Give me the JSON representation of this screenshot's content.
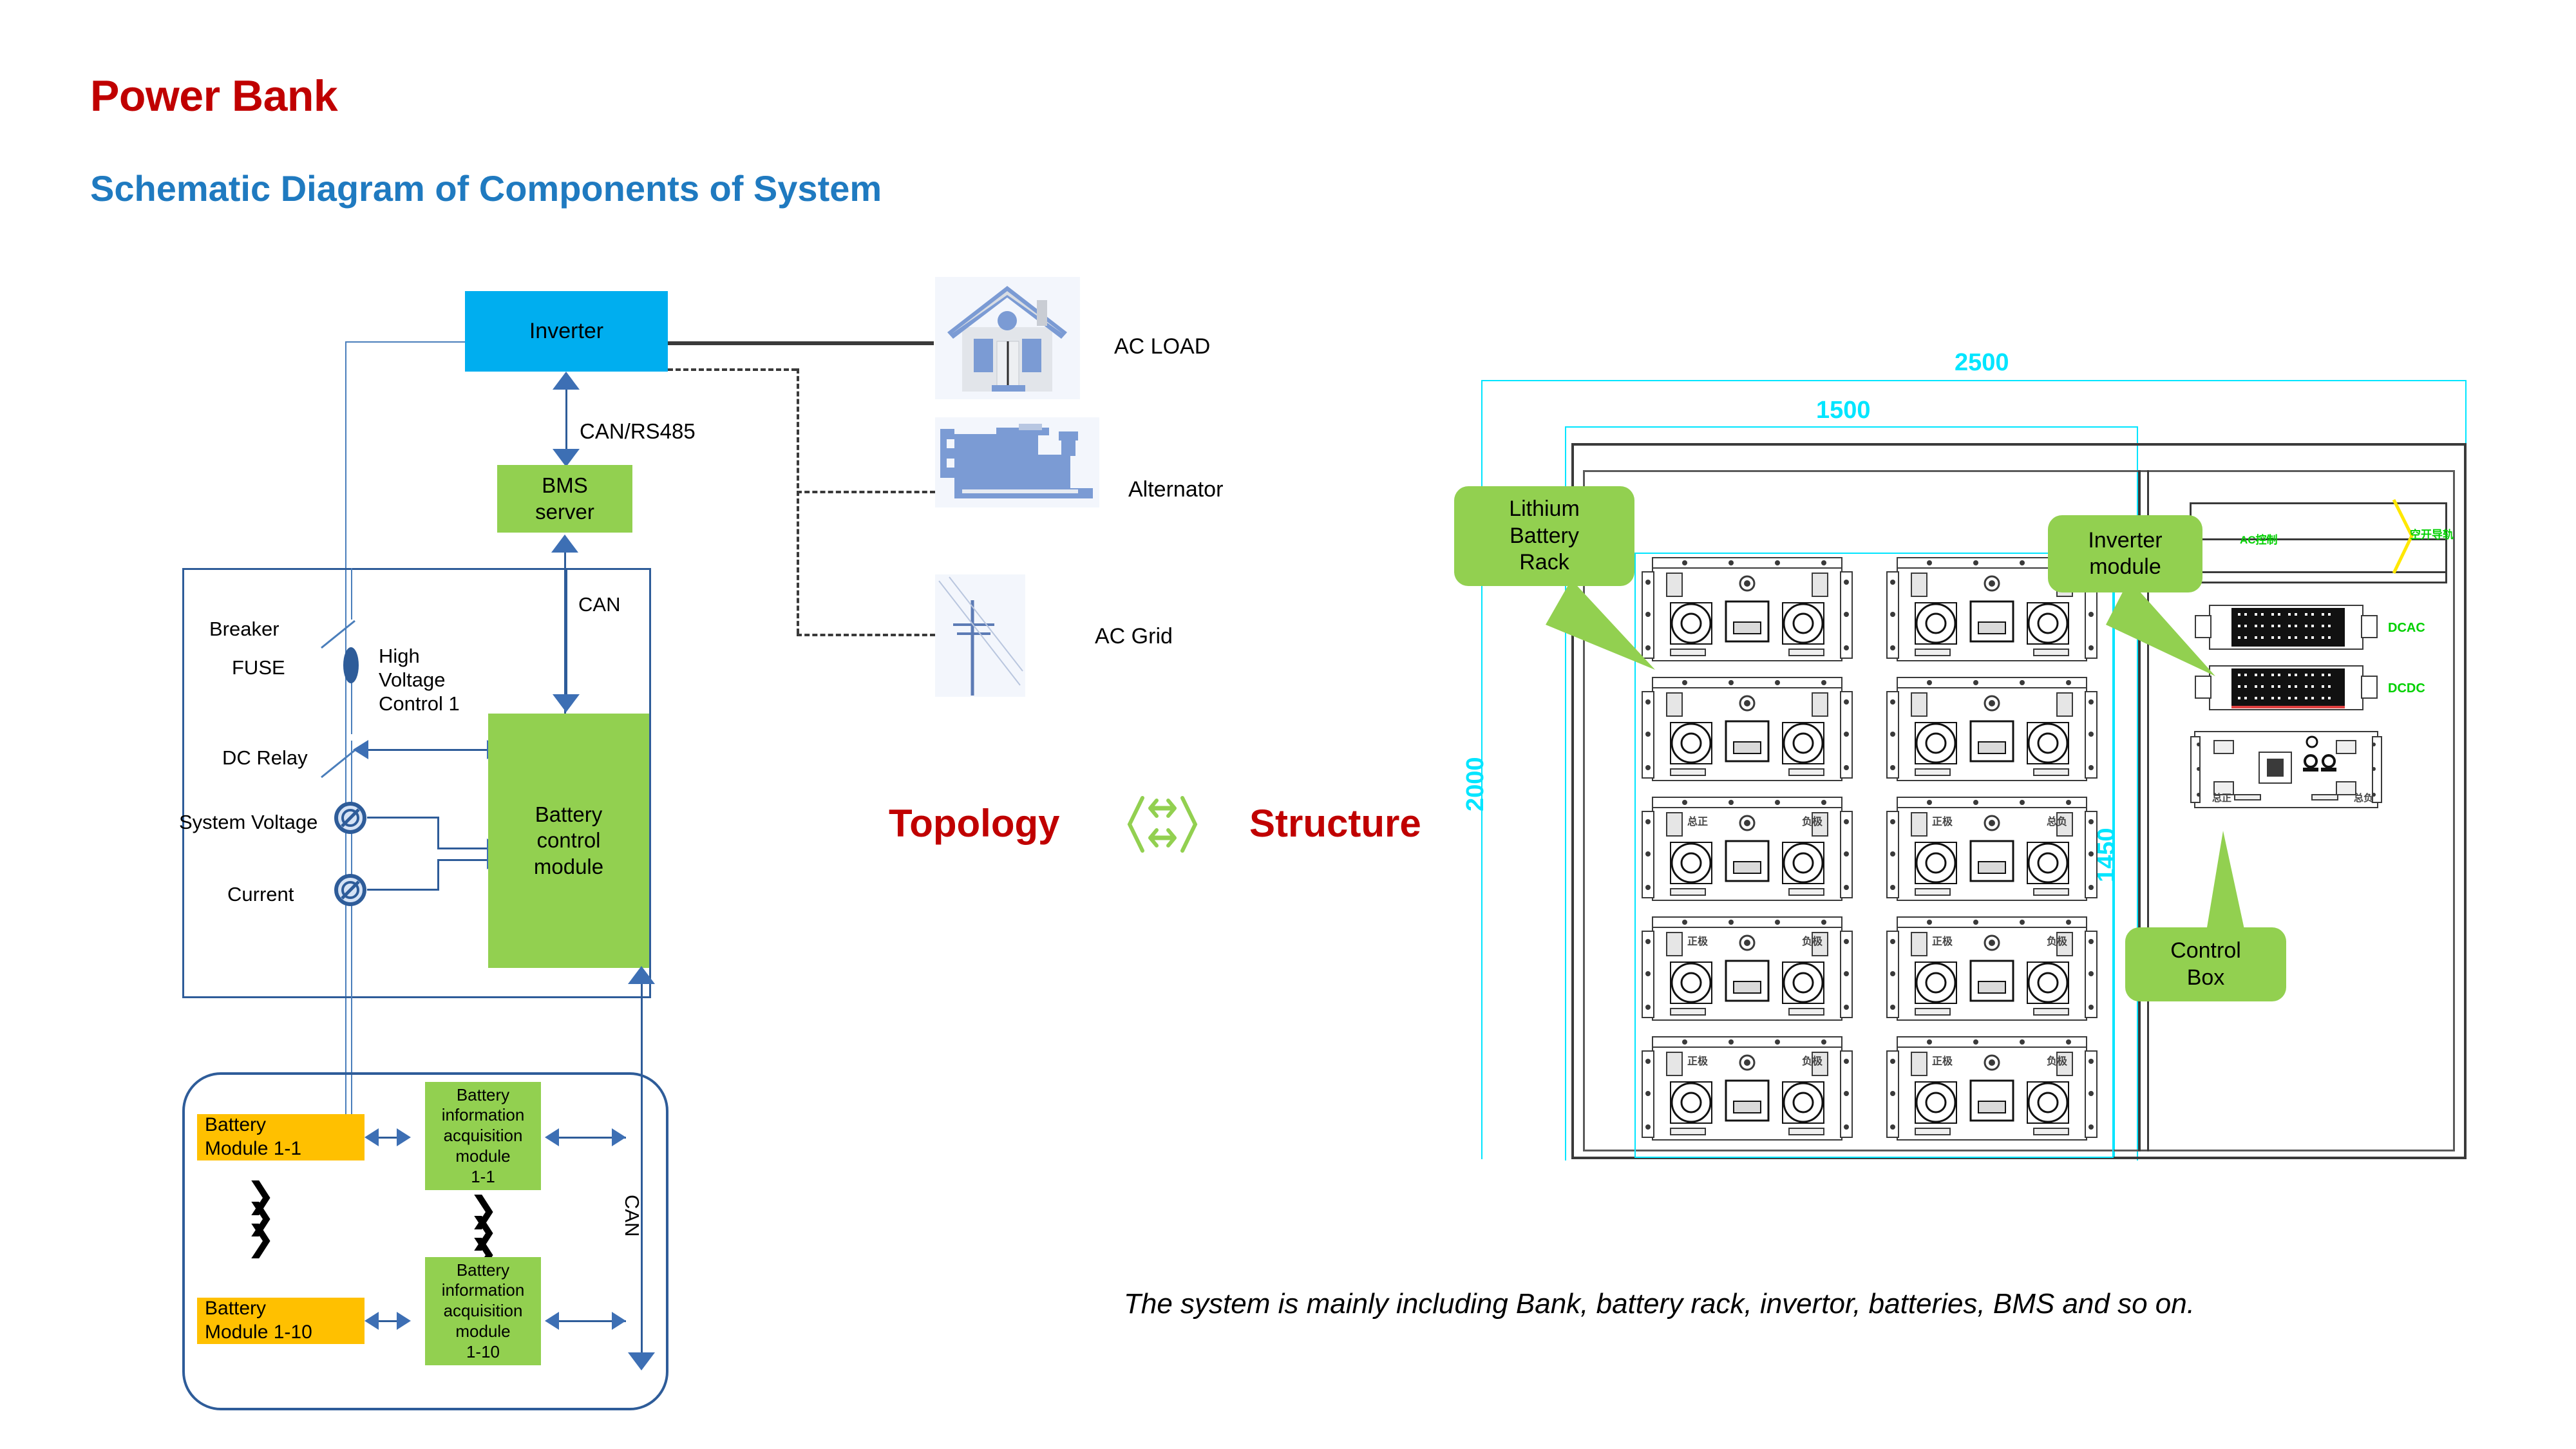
{
  "title": "Power Bank",
  "subtitle": "Schematic Diagram of Components of System",
  "topology": {
    "inverter": "Inverter",
    "can_rs485": "CAN/RS485",
    "bms_server": "BMS\nserver",
    "can_top": "CAN",
    "can_side": "CAN",
    "breaker": "Breaker",
    "fuse": "FUSE",
    "high_voltage_control": "High\nVoltage\nControl 1",
    "dc_relay": "DC Relay",
    "system_voltage": "System Voltage",
    "current": "Current",
    "battery_control_module": "Battery\ncontrol\nmodule",
    "battery_module_first": "Battery\nModule 1-1",
    "battery_module_last": "Battery\nModule 1-10",
    "acq_module_first": "Battery\ninformation\nacquisition\nmodule\n1-1",
    "acq_module_last": "Battery\ninformation\nacquisition\nmodule\n1-10"
  },
  "loads": [
    {
      "label": "AC LOAD",
      "icon": "house-icon"
    },
    {
      "label": "Alternator",
      "icon": "generator-icon"
    },
    {
      "label": "AC Grid",
      "icon": "utility-pole-icon"
    }
  ],
  "middle": {
    "left_word": "Topology",
    "right_word": "Structure",
    "exchange_icon": "bidirectional-exchange-icon"
  },
  "structure": {
    "dim_outer_width": "2500",
    "dim_inner_width": "1500",
    "dim_outer_height": "2000",
    "dim_inner_height": "1450",
    "callouts": [
      {
        "id": "lithium-battery-rack",
        "label": "Lithium\nBattery\nRack"
      },
      {
        "id": "inverter-module",
        "label": "Inverter\nmodule"
      },
      {
        "id": "control-box",
        "label": "Control\nBox"
      }
    ],
    "module_tags": [
      {
        "label": "DCAC"
      },
      {
        "label": "DCDC"
      }
    ],
    "cn_labels": {
      "ac_control": "AC控制",
      "air_switch": "空开导轨",
      "main_positive": "总正",
      "main_negative": "总负",
      "positive": "正极",
      "negative": "负极"
    },
    "battery_rack_rows": 5,
    "battery_rack_cols": 2
  },
  "caption": "The system is mainly including Bank, battery rack, invertor, batteries, BMS and so on.",
  "colors": {
    "title_red": "#C00000",
    "subtitle_blue": "#1F7AC0",
    "inverter_blue": "#00AEEF",
    "module_green": "#92D050",
    "battery_orange": "#FFC000",
    "wire_blue": "#2E5C99",
    "dimension_cyan": "#00E5FF",
    "cad_green": "#00D000"
  }
}
